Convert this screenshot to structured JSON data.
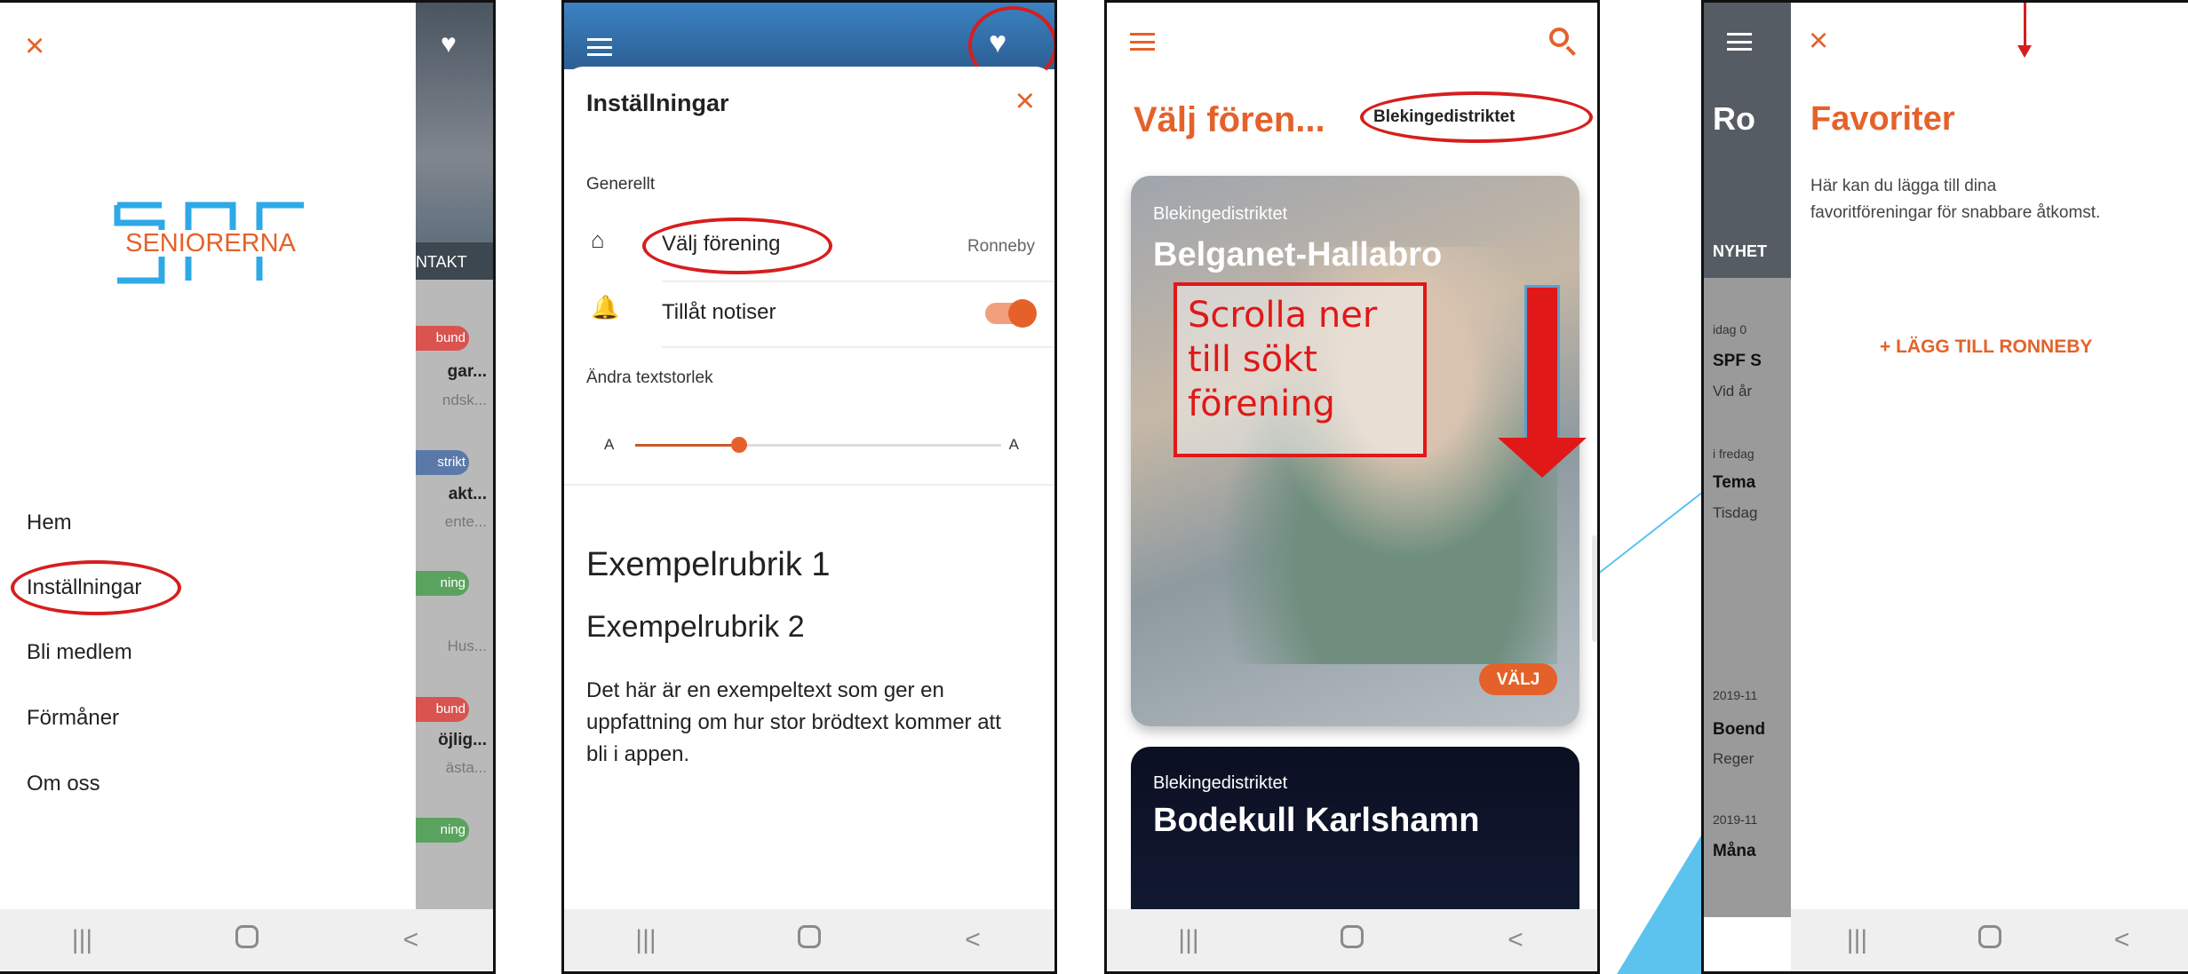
{
  "colors": {
    "accent": "#e4622a",
    "annotation_red": "#d61e1e",
    "brand_blue": "#2ea9e6"
  },
  "screen1": {
    "logo_text": "SENIORERNA",
    "menu": [
      "Hem",
      "Inställningar",
      "Bli medlem",
      "Förmåner",
      "Om oss"
    ],
    "background_tab": "NTAKT",
    "chips": [
      "bund",
      "strikt",
      "ning",
      "bund",
      "ning"
    ],
    "snippets": [
      "gar...",
      "ndsk...",
      "akt...",
      "ente...",
      "Hus...",
      "öjlig...",
      "ästa..."
    ]
  },
  "screen2": {
    "title": "Inställningar",
    "section_general": "Generellt",
    "row_association_label": "Välj förening",
    "row_association_value": "Ronneby",
    "row_notifications_label": "Tillåt notiser",
    "section_textsize": "Ändra textstorlek",
    "slider_min": "A",
    "slider_max": "A",
    "slider_level": 0.28,
    "heading1": "Exempelrubrik 1",
    "heading2": "Exempelrubrik 2",
    "body": "Det här är en exempeltext som ger en uppfattning om hur stor brödtext kommer att bli i appen."
  },
  "screen3": {
    "title": "Välj fören...",
    "district": "Blekingedistriktet",
    "cards": [
      {
        "district": "Blekingedistriktet",
        "name": "Belganet-Hallabro",
        "button": "VÄLJ"
      },
      {
        "district": "Blekingedistriktet",
        "name": "Bodekull Karlshamn"
      }
    ],
    "annotation": [
      "Scrolla ner",
      "till sökt",
      "förening"
    ]
  },
  "screen4": {
    "title": "Favoriter",
    "description": "Här kan du lägga till dina favoritföreningar för snabbare åtkomst.",
    "add_button": "+ LÄGG TILL RONNEBY",
    "background_title": "Ro",
    "background_tab": "NYHET",
    "background_items": [
      {
        "date": "idag 0",
        "title": "SPF S",
        "sub": "Vid år"
      },
      {
        "date": "i fredag",
        "title": "Tema",
        "sub": "Tisdag"
      },
      {
        "date": "2019-11",
        "title": "Boend",
        "sub": "Reger"
      },
      {
        "date": "2019-11",
        "title": "Måna",
        "sub": ""
      }
    ]
  },
  "navbar": {
    "recent": "|||",
    "back": "<"
  }
}
